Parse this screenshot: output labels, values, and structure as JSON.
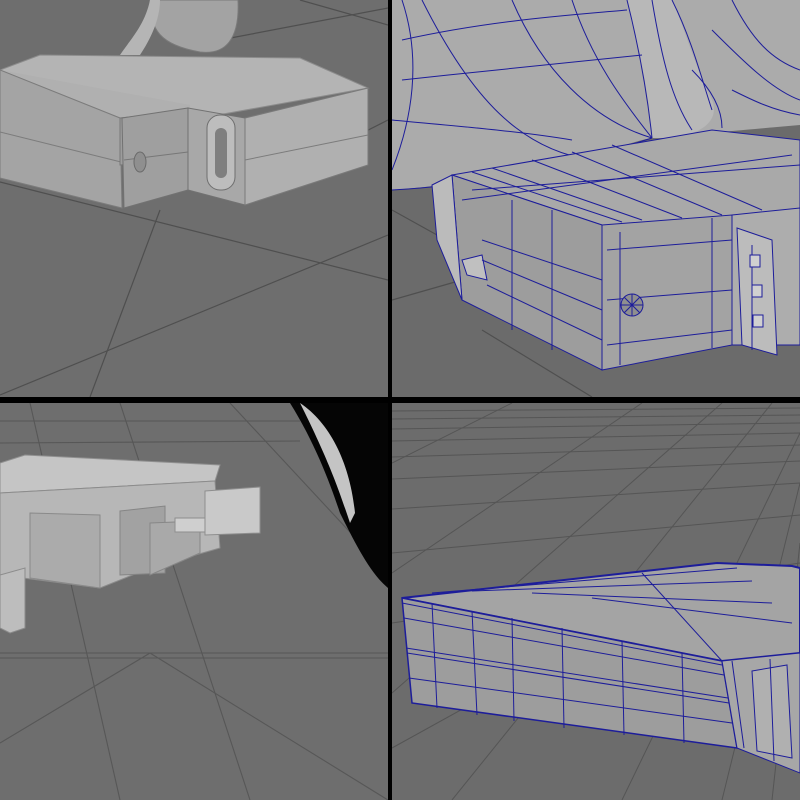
{
  "app": {
    "viewport_layout": "four-pane",
    "background_color": "#6f6f6f",
    "grid_line_color": "#555555",
    "wireframe_color": "#1a1a8c"
  },
  "viewports": [
    {
      "id": "top-left",
      "shading": "smooth-shaded",
      "subject": "box-model"
    },
    {
      "id": "top-right",
      "shading": "wireframe-on-shaded",
      "subject": "box-model"
    },
    {
      "id": "bottom-left",
      "shading": "smooth-shaded",
      "subject": "box-model"
    },
    {
      "id": "bottom-right",
      "shading": "wireframe-on-shaded",
      "subject": "box-model"
    }
  ]
}
